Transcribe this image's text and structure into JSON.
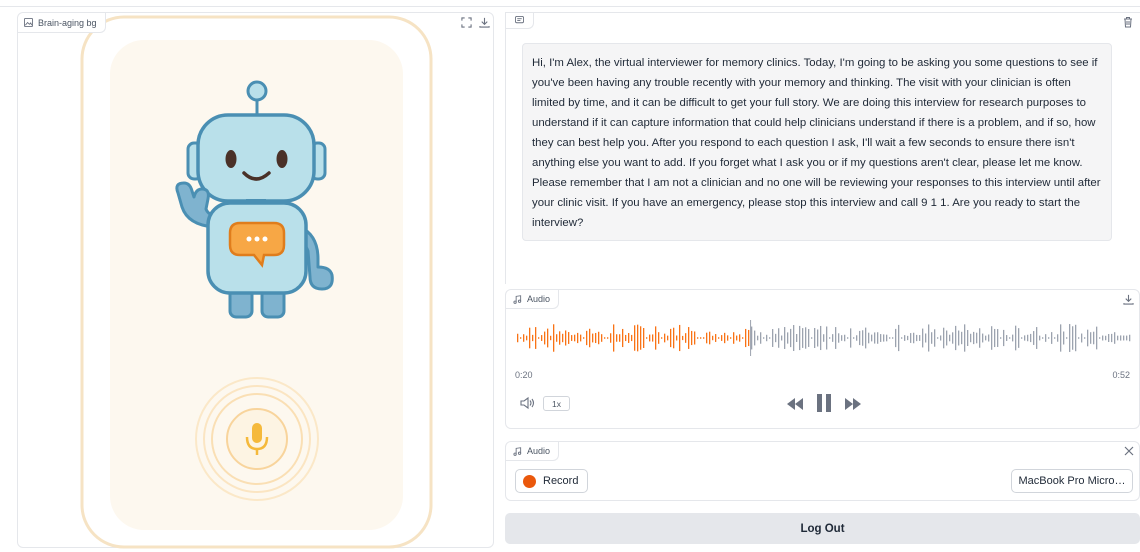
{
  "image_panel": {
    "label": "Brain-aging bg",
    "label_icon": "image-icon",
    "fullscreen_icon": "fullscreen-icon",
    "download_icon": "download-icon"
  },
  "chat": {
    "label_icon": "chat-icon",
    "clear_icon": "trash-icon",
    "message": "Hi, I'm Alex, the virtual interviewer for memory clinics. Today, I'm going to be asking you some questions to see if you've been having any trouble recently with your memory and thinking. The visit with your clinician is often limited by time, and it can be difficult to get your full story. We are doing this interview for research purposes to understand if it can capture information that could help clinicians understand if there is a problem, and if so, how they can best help you. After you respond to each question I ask, I'll wait a few seconds to ensure there isn't anything else you want to add. If you forget what I ask you or if my questions aren't clear, please let me know. Please remember that I am not a clinician and no one will be reviewing your responses to this interview until after your clinic visit. If you have an emergency, please stop this interview and call 9 1 1. Are you ready to start the interview?"
  },
  "audio_player": {
    "label": "Audio",
    "current_time": "0:20",
    "duration": "0:52",
    "progress_fraction": 0.38,
    "speed": "1x",
    "played_color": "#f97316",
    "unplayed_color": "#9ca3af"
  },
  "recorder": {
    "label": "Audio",
    "record_label": "Record",
    "device": "MacBook Pro Micro…",
    "record_color": "#ea580c"
  },
  "logout_label": "Log Out",
  "colors": {
    "accent": "#f97316",
    "robot_body": "#b9e0ea",
    "robot_outline": "#4a8fb3",
    "scene_bg": "#fdf8ef"
  }
}
